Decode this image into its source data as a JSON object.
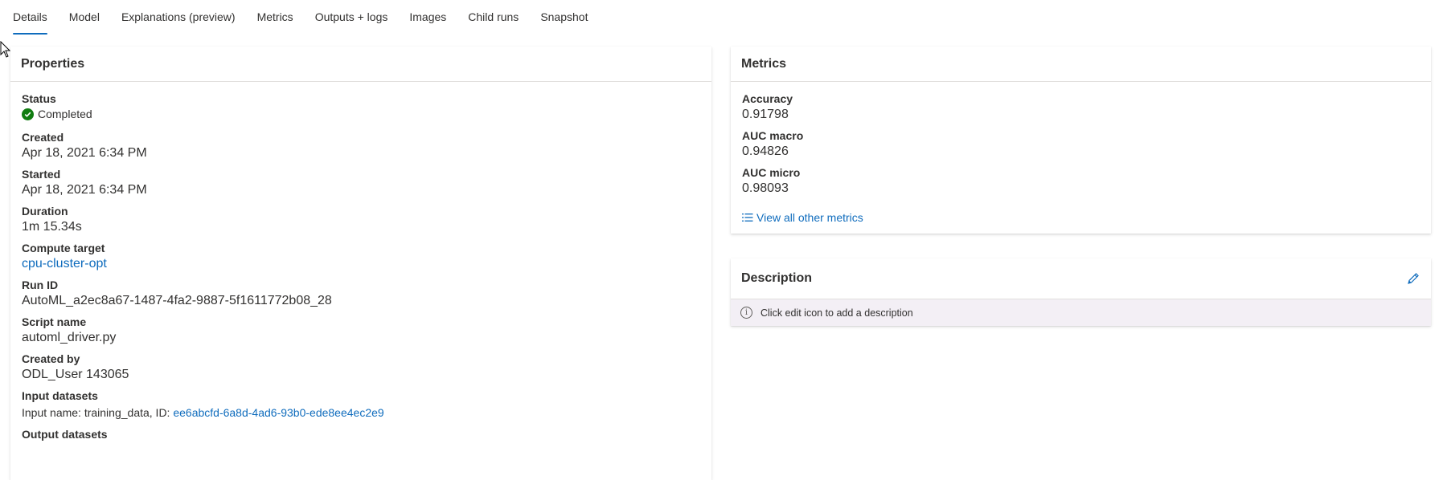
{
  "tabs": [
    {
      "label": "Details",
      "active": true
    },
    {
      "label": "Model"
    },
    {
      "label": "Explanations (preview)"
    },
    {
      "label": "Metrics"
    },
    {
      "label": "Outputs + logs"
    },
    {
      "label": "Images"
    },
    {
      "label": "Child runs"
    },
    {
      "label": "Snapshot"
    }
  ],
  "properties": {
    "title": "Properties",
    "status_label": "Status",
    "status_value": "Completed",
    "created_label": "Created",
    "created_value": "Apr 18, 2021 6:34 PM",
    "started_label": "Started",
    "started_value": "Apr 18, 2021 6:34 PM",
    "duration_label": "Duration",
    "duration_value": "1m 15.34s",
    "compute_label": "Compute target",
    "compute_value": "cpu-cluster-opt",
    "runid_label": "Run ID",
    "runid_value": "AutoML_a2ec8a67-1487-4fa2-9887-5f1611772b08_28",
    "script_label": "Script name",
    "script_value": "automl_driver.py",
    "createdby_label": "Created by",
    "createdby_value": "ODL_User 143065",
    "input_label": "Input datasets",
    "input_prefix": "Input name: training_data, ID:",
    "input_id": "ee6abcfd-6a8d-4ad6-93b0-ede8ee4ec2e9",
    "output_label": "Output datasets"
  },
  "metrics": {
    "title": "Metrics",
    "accuracy_label": "Accuracy",
    "accuracy_value": "0.91798",
    "auc_macro_label": "AUC macro",
    "auc_macro_value": "0.94826",
    "auc_micro_label": "AUC micro",
    "auc_micro_value": "0.98093",
    "view_all": "View all other metrics"
  },
  "description": {
    "title": "Description",
    "placeholder": "Click edit icon to add a description"
  },
  "colors": {
    "accent": "#0f6cbd",
    "success": "#107c10",
    "desc_bar": "#f3eff5"
  },
  "icons": [
    "status-success-icon",
    "list-icon",
    "info-icon",
    "edit-pencil-icon",
    "mouse-pointer-icon"
  ]
}
